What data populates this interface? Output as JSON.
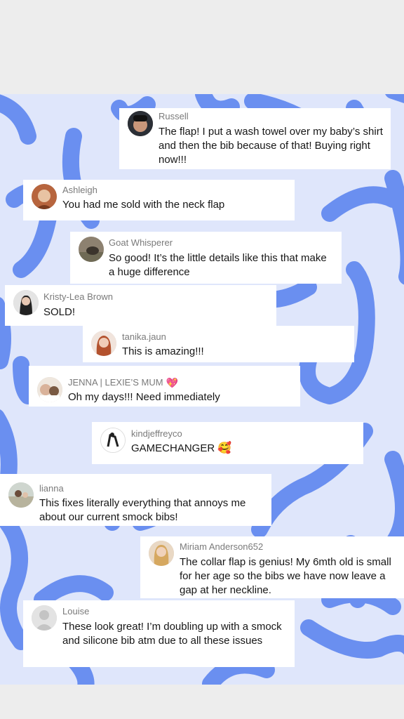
{
  "comments": [
    {
      "user": "Russell",
      "text": "The flap! I put a wash towel over my baby’s shirt and then the bib because of that! Buying right now!!!"
    },
    {
      "user": "Ashleigh",
      "text": "You had me sold with the neck flap"
    },
    {
      "user": "Goat Whisperer",
      "text": "So good! It’s the little details like this that make a huge difference"
    },
    {
      "user": "Kristy-Lea Brown",
      "text": "SOLD!"
    },
    {
      "user": "tanika.jaun",
      "text": "This is amazing!!!"
    },
    {
      "user": "JENNA | LEXIE’S MUM",
      "user_emoji": "💖",
      "text": "Oh my days!!! Need immediately"
    },
    {
      "user": "kindjeffreyco",
      "text": "GAMECHANGER",
      "text_emoji": "🥰"
    },
    {
      "user": "lianna",
      "text": "This fixes literally everything that annoys me about our current smock bibs!"
    },
    {
      "user": "Miriam Anderson652",
      "text": "The collar flap is genius! My 6mth old is small for her age so the bibs we have now leave a gap at her neckline."
    },
    {
      "user": "Louise",
      "text": "These look great! I’m doubling up with a smock and silicone bib atm due to all these issues"
    }
  ],
  "colors": {
    "background": "#dfe6fb",
    "squiggle": "#6a8ff0",
    "card": "#ffffff",
    "username": "#7a7a7a",
    "text": "#161616"
  }
}
